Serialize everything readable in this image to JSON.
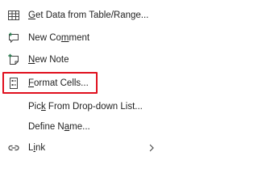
{
  "menu": {
    "items": [
      {
        "id": "get-data",
        "pre": "",
        "ul": "G",
        "post": "et Data from Table/Range...",
        "icon": "table-icon"
      },
      {
        "id": "new-comment",
        "pre": "New Co",
        "ul": "m",
        "post": "ment",
        "icon": "comment-icon"
      },
      {
        "id": "new-note",
        "pre": "",
        "ul": "N",
        "post": "ew Note",
        "icon": "note-icon"
      },
      {
        "id": "format-cells",
        "pre": "",
        "ul": "F",
        "post": "ormat Cells...",
        "icon": "format-cells-icon"
      },
      {
        "id": "pick-list",
        "pre": "Pic",
        "ul": "k",
        "post": " From Drop-down List...",
        "icon": ""
      },
      {
        "id": "define-name",
        "pre": "Define N",
        "ul": "a",
        "post": "me...",
        "icon": ""
      },
      {
        "id": "link",
        "pre": "L",
        "ul": "i",
        "post": "nk",
        "icon": "link-icon"
      }
    ]
  },
  "colors": {
    "highlight": "#e0101e",
    "icon_green": "#217346",
    "icon_dark": "#444444"
  }
}
